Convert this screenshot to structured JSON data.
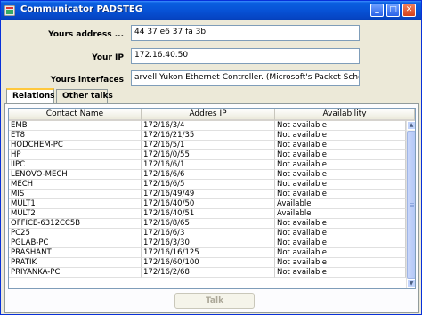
{
  "window": {
    "title": "Communicator PADSTEG",
    "controls": {
      "minimize_icon": "minimize-icon",
      "maximize_icon": "maximize-icon",
      "close_icon": "close-icon"
    },
    "controls_glyphs": {
      "minimize": "_",
      "maximize": "□",
      "close": "✕"
    }
  },
  "form": {
    "address_label": "Yours address ...",
    "address_value": "44 37 e6 37  fa 3b",
    "ip_label": "Your IP",
    "ip_value": "172.16.40.50",
    "interfaces_label": "Yours interfaces",
    "interfaces_value": "arvell Yukon Ethernet Controller. (Microsoft's Packet Scheduler)"
  },
  "tabs": [
    {
      "label": "Relations",
      "active": true
    },
    {
      "label": "Other talks",
      "active": false
    }
  ],
  "table": {
    "columns": [
      "Contact Name",
      "Addres IP",
      "Availability"
    ],
    "rows": [
      [
        "EMB",
        "172/16/3/4",
        "Not available"
      ],
      [
        "ET8",
        "172/16/21/35",
        "Not available"
      ],
      [
        "HODCHEM-PC",
        "172/16/5/1",
        "Not available"
      ],
      [
        "HP",
        "172/16/0/55",
        "Not available"
      ],
      [
        "IIPC",
        "172/16/6/1",
        "Not available"
      ],
      [
        "LENOVO-MECH",
        "172/16/6/6",
        "Not available"
      ],
      [
        "MECH",
        "172/16/6/5",
        "Not available"
      ],
      [
        "MIS",
        "172/16/49/49",
        "Not available"
      ],
      [
        "MULT1",
        "172/16/40/50",
        "Available"
      ],
      [
        "MULT2",
        "172/16/40/51",
        "Available"
      ],
      [
        "OFFICE-6312CC5B",
        "172/16/8/65",
        "Not available"
      ],
      [
        "PC25",
        "172/16/6/3",
        "Not available"
      ],
      [
        "PGLAB-PC",
        "172/16/3/30",
        "Not available"
      ],
      [
        "PRASHANT",
        "172/16/16/125",
        "Not available"
      ],
      [
        "PRATIK",
        "172/16/60/100",
        "Not available"
      ],
      [
        "PRIYANKA-PC",
        "172/16/2/68",
        "Not available"
      ]
    ]
  },
  "talk_button": {
    "label": "Talk",
    "enabled": false
  },
  "colors": {
    "title_bar": "#0752d6",
    "window_bg": "#ece9d8",
    "accent_tab": "#ffc83c"
  }
}
